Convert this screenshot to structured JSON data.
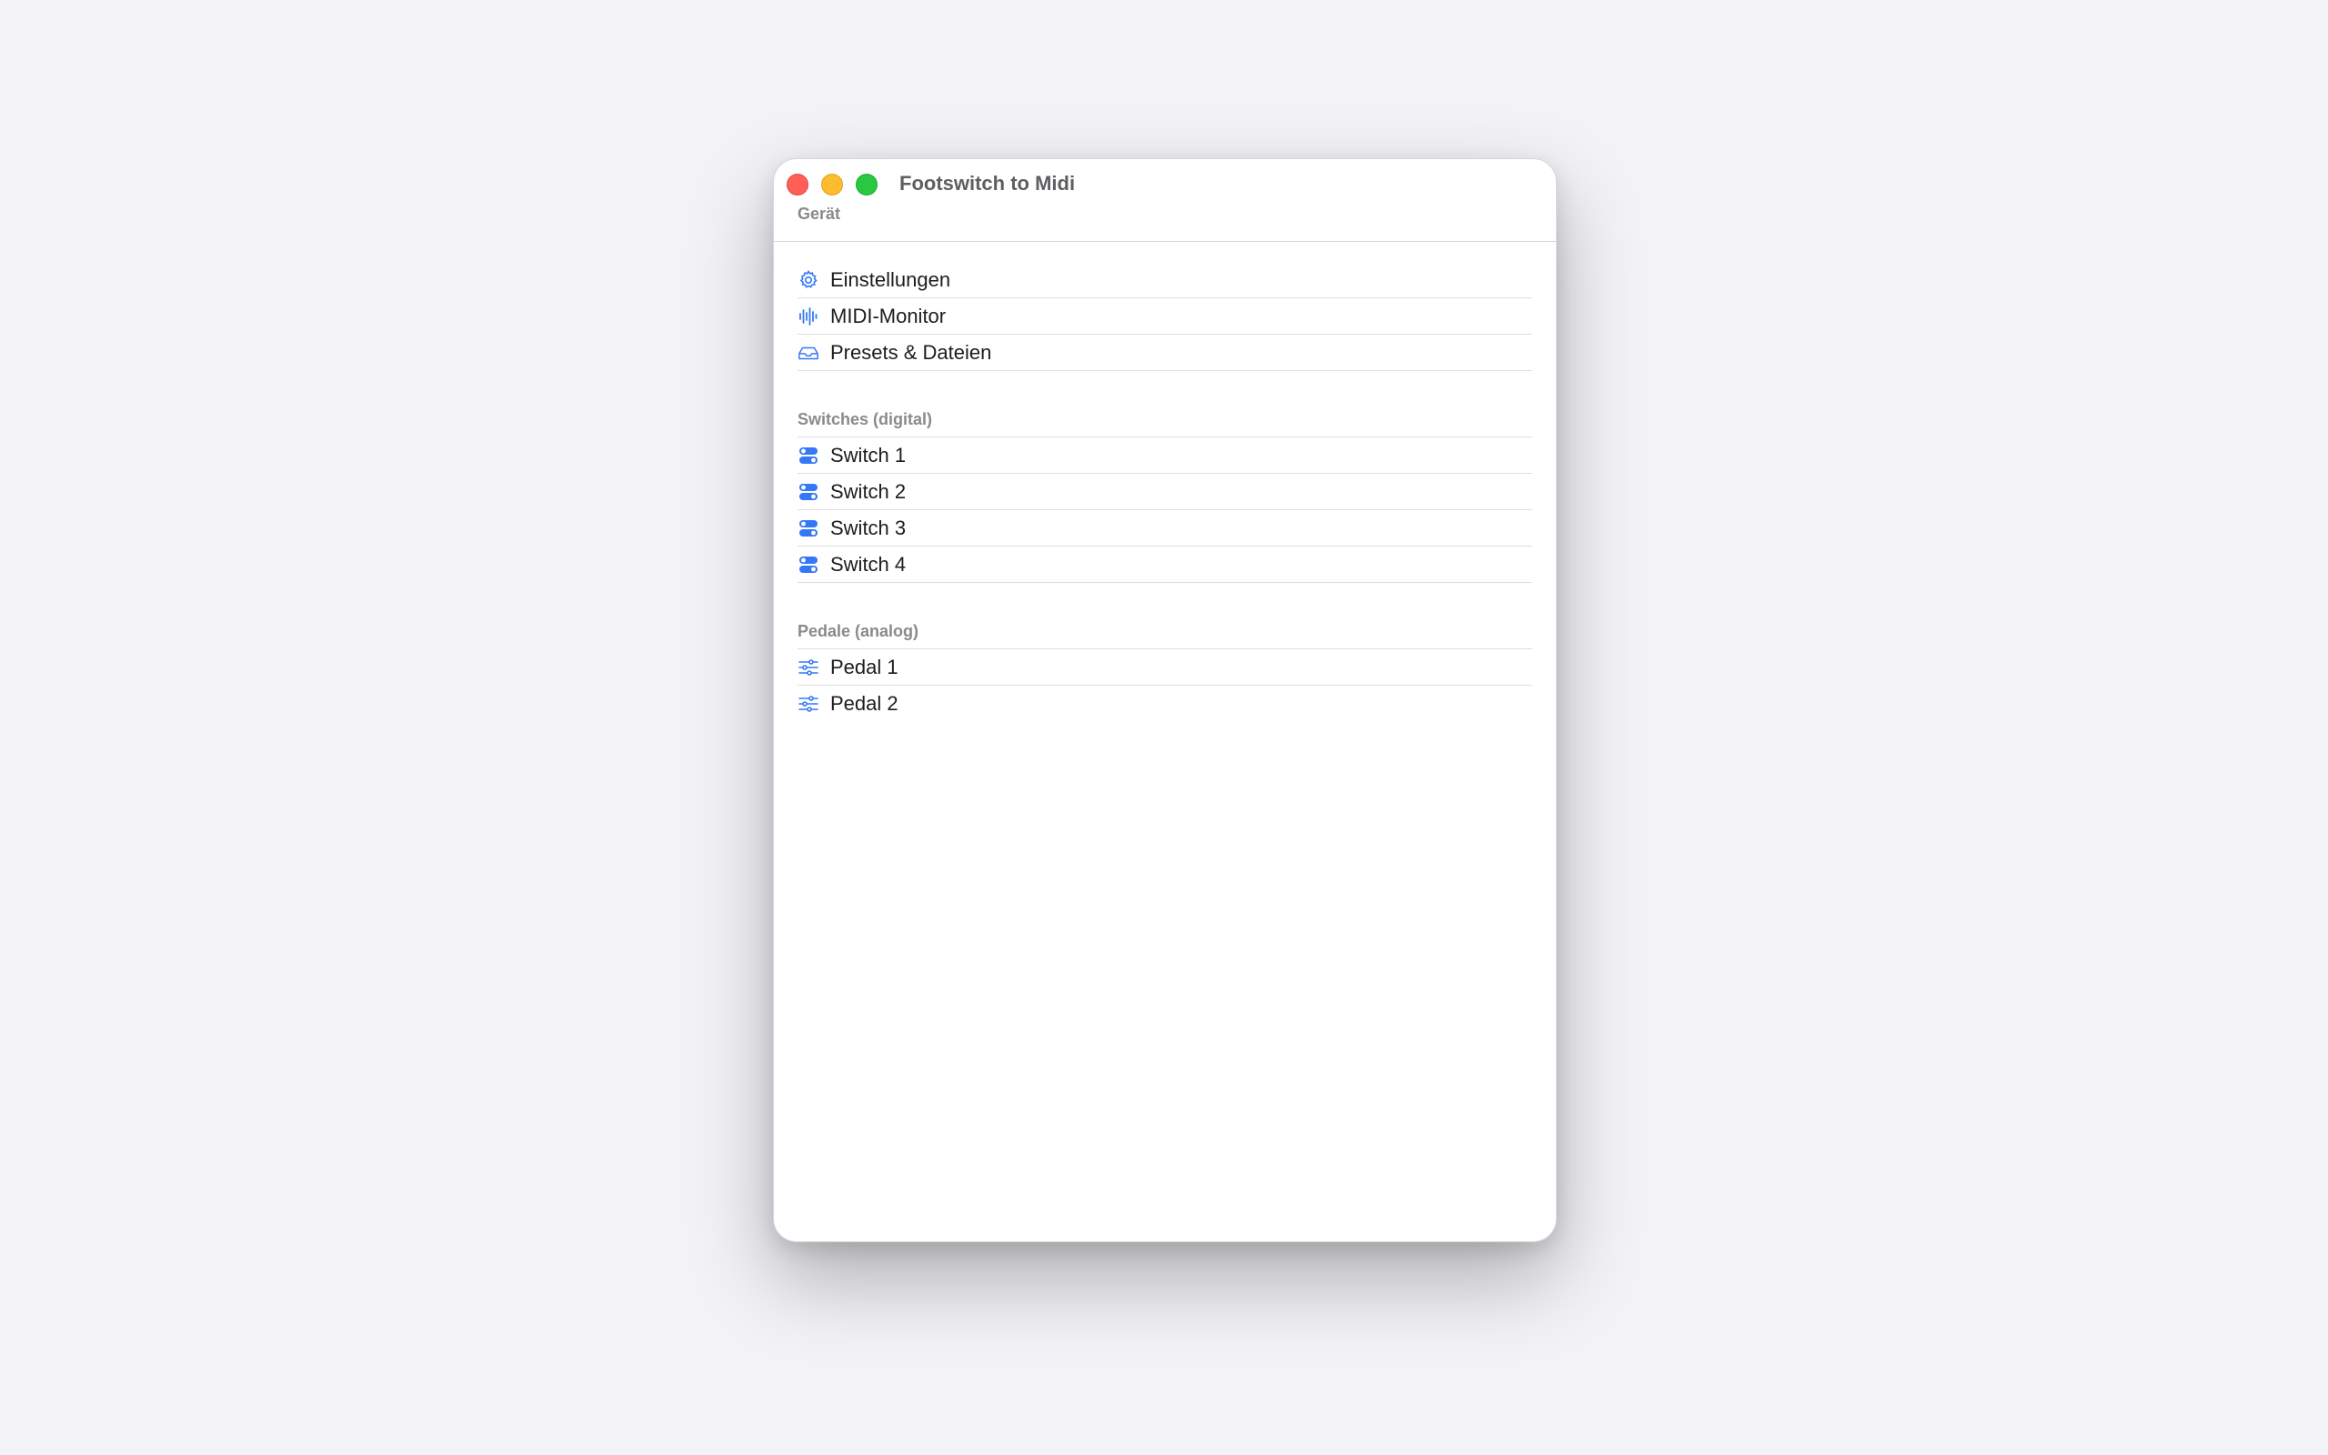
{
  "window": {
    "title": "Footswitch to Midi"
  },
  "sections": {
    "device": {
      "header": "Gerät",
      "items": [
        {
          "label": "Einstellungen",
          "icon": "gear-icon"
        },
        {
          "label": "MIDI-Monitor",
          "icon": "waveform-icon"
        },
        {
          "label": "Presets & Dateien",
          "icon": "tray-icon"
        }
      ]
    },
    "switches": {
      "header": "Switches (digital)",
      "items": [
        {
          "label": "Switch 1",
          "icon": "switch-toggle-icon"
        },
        {
          "label": "Switch 2",
          "icon": "switch-toggle-icon"
        },
        {
          "label": "Switch 3",
          "icon": "switch-toggle-icon"
        },
        {
          "label": "Switch 4",
          "icon": "switch-toggle-icon"
        }
      ]
    },
    "pedals": {
      "header": "Pedale (analog)",
      "items": [
        {
          "label": "Pedal 1",
          "icon": "sliders-icon"
        },
        {
          "label": "Pedal 2",
          "icon": "sliders-icon"
        }
      ]
    }
  },
  "colors": {
    "accent": "#3478f6",
    "close": "#ff5f57",
    "minimize": "#febc2e",
    "zoom": "#28c840"
  }
}
